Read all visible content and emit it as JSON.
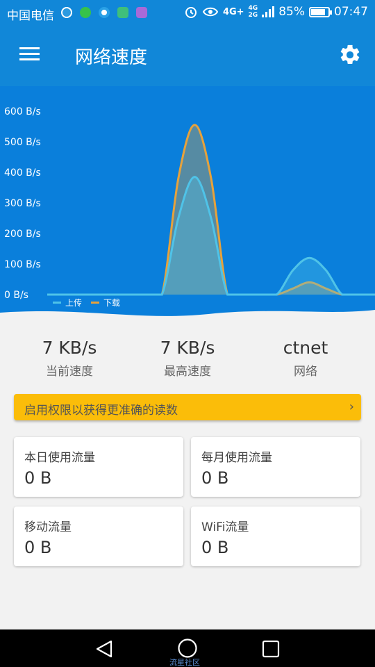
{
  "status_bar": {
    "carrier": "中国电信",
    "network_primary": "4G+",
    "network_secondary": "4G",
    "network_secondary_sub": "2G",
    "battery_text": "85%",
    "battery_level": 0.85,
    "time": "07:47",
    "icons": [
      "data-saver-icon",
      "wechat-icon",
      "app-icon",
      "photo-icon",
      "gallery-icon",
      "alarm-icon",
      "eye-icon",
      "signal-icon",
      "battery-icon"
    ]
  },
  "app_bar": {
    "title": "网络速度",
    "menu_icon": "hamburger-menu-icon",
    "settings_icon": "gear-icon"
  },
  "chart_data": {
    "type": "area",
    "ylim": [
      0,
      600
    ],
    "y_ticks": [
      "0 B/s",
      "100 B/s",
      "200 B/s",
      "300 B/s",
      "400 B/s",
      "500 B/s",
      "600 B/s"
    ],
    "x_samples": [
      0,
      1,
      2,
      3,
      4,
      5,
      6,
      7,
      8,
      9,
      10,
      11,
      12,
      13,
      14,
      15,
      16,
      17,
      18,
      19,
      20
    ],
    "series": [
      {
        "name": "上传",
        "color": "#4fc3e8",
        "values": [
          0,
          0,
          0,
          0,
          0,
          0,
          0,
          0,
          250,
          385,
          250,
          0,
          0,
          0,
          0,
          80,
          120,
          80,
          0,
          0,
          0
        ]
      },
      {
        "name": "下载",
        "color": "#e6a23c",
        "values": [
          0,
          0,
          0,
          0,
          0,
          0,
          0,
          0,
          380,
          555,
          380,
          0,
          0,
          0,
          0,
          20,
          40,
          20,
          0,
          0,
          0
        ]
      }
    ],
    "legend_position": "bottom-left",
    "grid": false
  },
  "stats": [
    {
      "value": "7 KB/s",
      "label": "当前速度"
    },
    {
      "value": "7 KB/s",
      "label": "最高速度"
    },
    {
      "value": "ctnet",
      "label": "网络"
    }
  ],
  "permission_banner": {
    "text": "启用权限以获得更准确的读数",
    "chevron": "›",
    "color": "#fbbd09"
  },
  "usage_cards": [
    {
      "label": "本日使用流量",
      "value": "0 B"
    },
    {
      "label": "每月使用流量",
      "value": "0 B"
    },
    {
      "label": "移动流量",
      "value": "0 B"
    },
    {
      "label": "WiFi流量",
      "value": "0 B"
    }
  ],
  "nav_bar": {
    "back_icon": "back-triangle-icon",
    "home_icon": "home-circle-icon",
    "recents_icon": "recents-square-icon"
  },
  "watermark": "流星社区",
  "colors": {
    "primary": "#1187d8",
    "chart_bg": "#0a7fdb",
    "upload": "#4fc3e8",
    "download": "#e6a23c",
    "banner": "#fbbd09"
  }
}
